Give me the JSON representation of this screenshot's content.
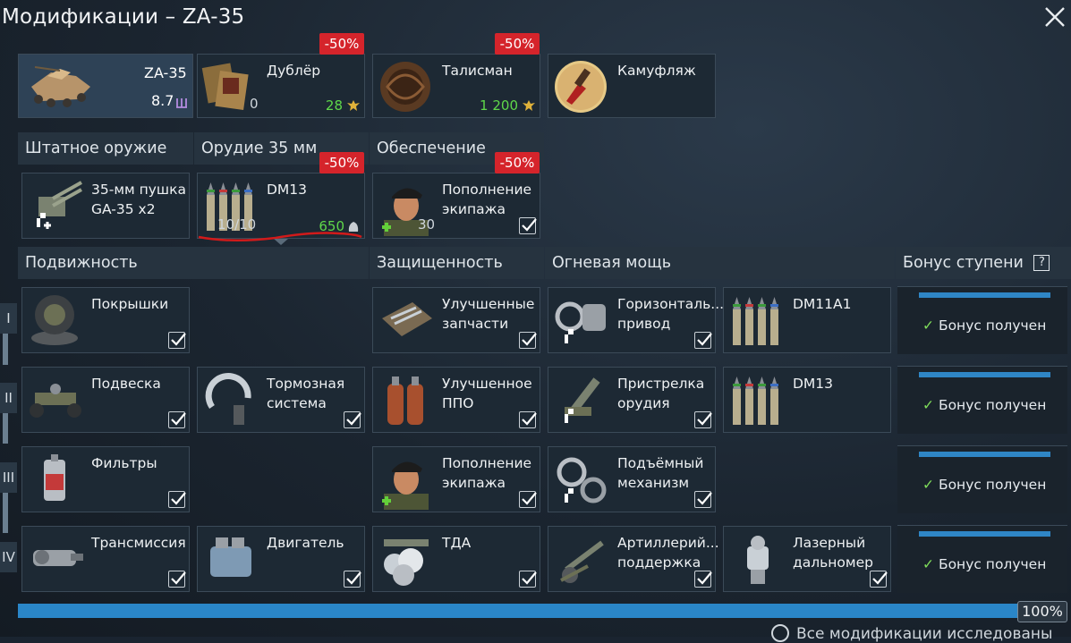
{
  "window": {
    "title": "Модификации – ZA-35"
  },
  "vehicle": {
    "name": "ZA-35",
    "br": "8.7"
  },
  "crew_row": [
    {
      "label": "Дублёр",
      "count": "0",
      "price": "28",
      "discount": "-50%"
    },
    {
      "label": "Талисман",
      "price": "1 200",
      "discount": "-50%"
    },
    {
      "label": "Камуфляж"
    }
  ],
  "weapon_headers": [
    "Штатное оружие",
    "Орудие 35 мм",
    "Обеспечение"
  ],
  "weapon_row": [
    {
      "label": "35-мм пушка GA-35 x2"
    },
    {
      "label": "DM13",
      "count": "10/10",
      "price": "650",
      "discount": "-50%"
    },
    {
      "label": "Пополнение экипажа",
      "count": "30",
      "discount": "-50%"
    }
  ],
  "sections": {
    "mobility": "Подвижность",
    "protection": "Защищенность",
    "firepower": "Огневая мощь",
    "bonus": "Бонус ступени",
    "bonus_help": "?"
  },
  "tiers": [
    "I",
    "II",
    "III",
    "IV"
  ],
  "mods": {
    "m1": "Покрышки",
    "m2": "Подвеска",
    "m3": "Тормозная система",
    "m4": "Фильтры",
    "m5": "Трансмиссия",
    "m6": "Двигатель",
    "p1": "Улучшенные запчасти",
    "p2": "Улучшенное ППО",
    "p3": "Пополнение экипажа",
    "p4": "ТДА",
    "f1": "Горизонталь... привод",
    "f2": "DM11A1",
    "f3": "Пристрелка орудия",
    "f4": "DM13",
    "f5": "Подъёмный механизм",
    "f6": "Артиллерий... поддержка",
    "f7": "Лазерный дальномер"
  },
  "bonus_text": "Бонус получен",
  "progress": {
    "percent": "100%",
    "value": 1.0
  },
  "footer": "Все модификации исследованы",
  "colors": {
    "accent": "#2f86c6",
    "discount": "#d5242b",
    "price": "#5fd84a"
  }
}
